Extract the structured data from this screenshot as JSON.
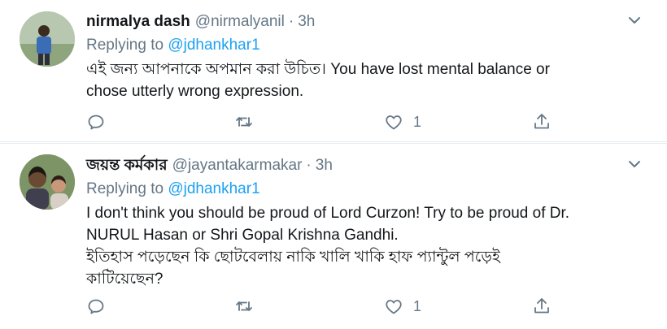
{
  "tweets": [
    {
      "name": "nirmalya dash",
      "handle": "@nirmalyanil",
      "dot": "·",
      "time": "3h",
      "replying_prefix": "Replying to ",
      "replying_to": "@jdhankhar1",
      "text": "এই জন্য আপনাকে অপমান করা উচিত। You have lost mental balance or\nchose utterly wrong expression.",
      "likes": "1",
      "icons": [
        "avatar",
        "chevron-down-icon",
        "reply-icon",
        "retweet-icon",
        "like-icon",
        "share-icon"
      ]
    },
    {
      "name": "জয়ন্ত কর্মকার",
      "handle": "@jayantakarmakar",
      "dot": "·",
      "time": "3h",
      "replying_prefix": "Replying to ",
      "replying_to": "@jdhankhar1",
      "text": "I don't think you should be proud of Lord Curzon! Try to be proud of Dr.\nNURUL Hasan or Shri Gopal Krishna Gandhi.\nইতিহাস পড়েছেন কি ছোটবেলায় নাকি খালি খাকি হাফ প্যান্টুল পড়েই\nকাটিয়েছেন?",
      "likes": "1",
      "icons": [
        "avatar",
        "chevron-down-icon",
        "reply-icon",
        "retweet-icon",
        "like-icon",
        "share-icon"
      ]
    }
  ],
  "colors": {
    "text": "#14171a",
    "muted": "#657786",
    "link": "#1da1f2",
    "divider": "#e6ecf0"
  }
}
